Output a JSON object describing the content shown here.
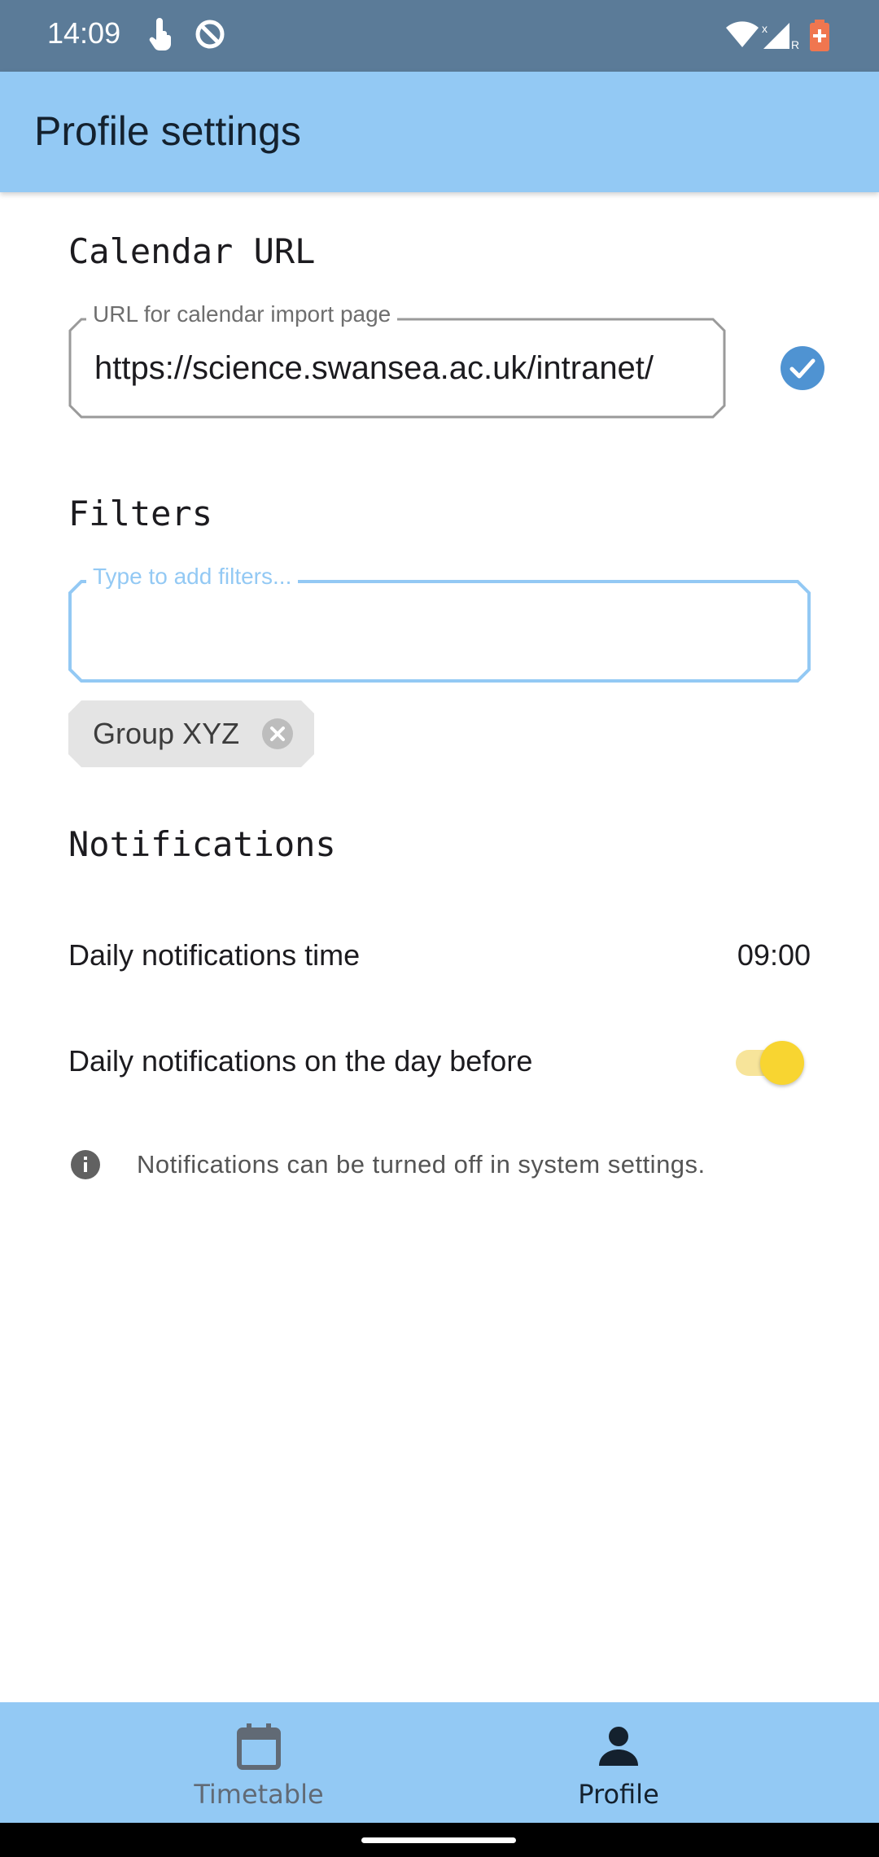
{
  "status_bar": {
    "time": "14:09"
  },
  "app_bar": {
    "title": "Profile settings"
  },
  "calendar": {
    "section_title": "Calendar URL",
    "field_label": "URL for calendar import page",
    "field_value": "https://science.swansea.ac.uk/intranet/"
  },
  "filters": {
    "section_title": "Filters",
    "placeholder": "Type to add filters...",
    "chips": [
      {
        "label": "Group XYZ"
      }
    ]
  },
  "notifications": {
    "section_title": "Notifications",
    "time_label": "Daily notifications time",
    "time_value": "09:00",
    "day_before_label": "Daily notifications on the day before",
    "day_before_enabled": true,
    "info_text": "Notifications can be turned off in system settings."
  },
  "bottom_nav": {
    "items": [
      {
        "label": "Timetable",
        "icon": "calendar-icon",
        "selected": false
      },
      {
        "label": "Profile",
        "icon": "person-icon",
        "selected": true
      }
    ]
  },
  "colors": {
    "app_bar": "#93c9f4",
    "status_bar": "#5b7b98",
    "accent": "#4f93d2",
    "toggle_thumb": "#f8d531"
  }
}
